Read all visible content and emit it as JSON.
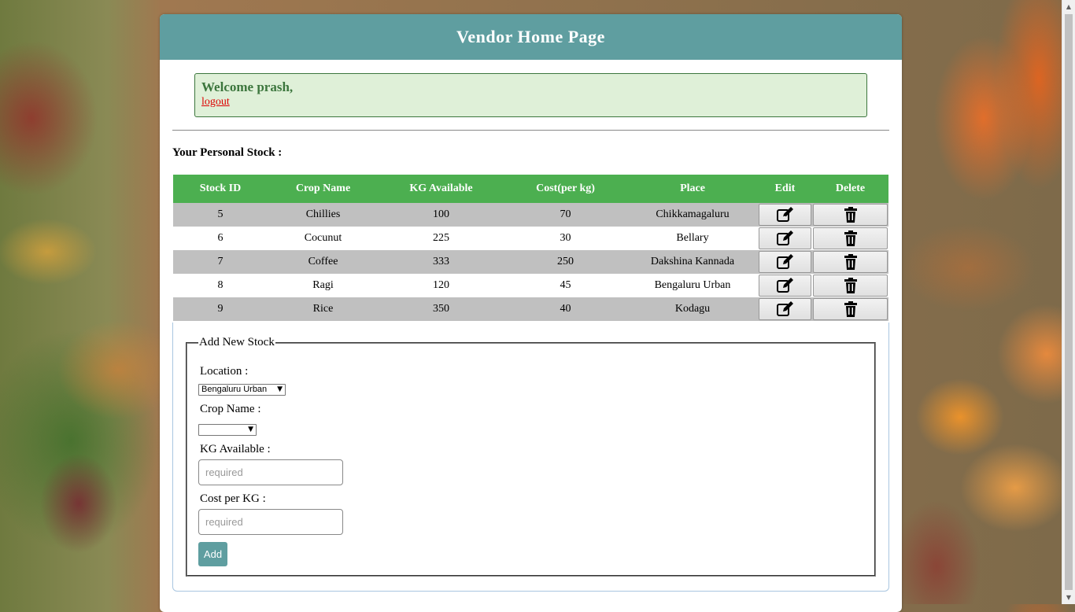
{
  "header": {
    "title": "Vendor Home Page"
  },
  "welcome": {
    "text": "Welcome prash,",
    "logout": "logout"
  },
  "stock": {
    "label": "Your Personal Stock :",
    "columns": [
      "Stock ID",
      "Crop Name",
      "KG Available",
      "Cost(per kg)",
      "Place",
      "Edit",
      "Delete"
    ],
    "rows": [
      {
        "id": "5",
        "crop": "Chillies",
        "kg": "100",
        "cost": "70",
        "place": "Chikkamagaluru"
      },
      {
        "id": "6",
        "crop": "Cocunut",
        "kg": "225",
        "cost": "30",
        "place": "Bellary"
      },
      {
        "id": "7",
        "crop": "Coffee",
        "kg": "333",
        "cost": "250",
        "place": "Dakshina Kannada"
      },
      {
        "id": "8",
        "crop": "Ragi",
        "kg": "120",
        "cost": "45",
        "place": "Bengaluru Urban"
      },
      {
        "id": "9",
        "crop": "Rice",
        "kg": "350",
        "cost": "40",
        "place": "Kodagu"
      }
    ],
    "edit_icon": "edit-icon",
    "delete_icon": "trash-icon"
  },
  "form": {
    "legend": "Add New Stock",
    "location_label": "Location :",
    "location_value": "Bengaluru Urban",
    "crop_label": "Crop Name :",
    "crop_value": "",
    "kg_label": "KG Available :",
    "kg_placeholder": "required",
    "cost_label": "Cost per KG :",
    "cost_placeholder": "required",
    "add_label": "Add"
  },
  "colors": {
    "header": "#5f9ea0",
    "table_header": "#4caf50",
    "welcome_bg": "#dff0d8",
    "welcome_text": "#3c763d",
    "logout": "#dd0000"
  }
}
